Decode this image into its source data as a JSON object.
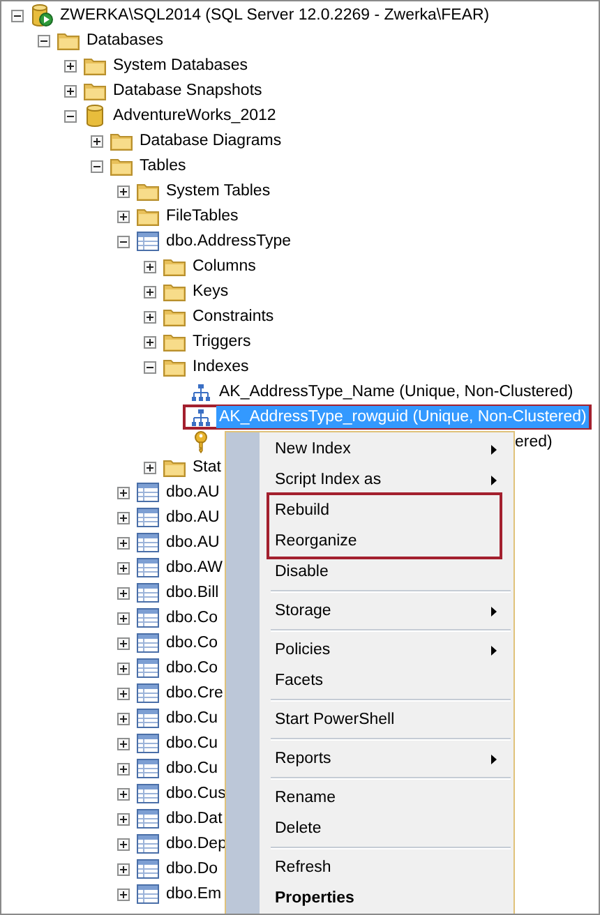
{
  "tree": [
    {
      "label": "ZWERKA\\SQL2014 (SQL Server 12.0.2269 - Zwerka\\FEAR)",
      "kind": "server",
      "expanded": true,
      "selected": false,
      "children": [
        {
          "label": "Databases",
          "kind": "folder",
          "expanded": true,
          "selected": false,
          "children": [
            {
              "label": "System Databases",
              "kind": "folder",
              "expanded": false,
              "selected": false
            },
            {
              "label": "Database Snapshots",
              "kind": "folder",
              "expanded": false,
              "selected": false
            },
            {
              "label": "AdventureWorks_2012",
              "kind": "database",
              "expanded": true,
              "selected": false,
              "children": [
                {
                  "label": "Database Diagrams",
                  "kind": "folder",
                  "expanded": false,
                  "selected": false
                },
                {
                  "label": "Tables",
                  "kind": "folder",
                  "expanded": true,
                  "selected": false,
                  "children": [
                    {
                      "label": "System Tables",
                      "kind": "folder",
                      "expanded": false,
                      "selected": false
                    },
                    {
                      "label": "FileTables",
                      "kind": "folder",
                      "expanded": false,
                      "selected": false
                    },
                    {
                      "label": "dbo.AddressType",
                      "kind": "table",
                      "expanded": true,
                      "selected": false,
                      "children": [
                        {
                          "label": "Columns",
                          "kind": "folder",
                          "expanded": false,
                          "selected": false
                        },
                        {
                          "label": "Keys",
                          "kind": "folder",
                          "expanded": false,
                          "selected": false
                        },
                        {
                          "label": "Constraints",
                          "kind": "folder",
                          "expanded": false,
                          "selected": false
                        },
                        {
                          "label": "Triggers",
                          "kind": "folder",
                          "expanded": false,
                          "selected": false
                        },
                        {
                          "label": "Indexes",
                          "kind": "folder",
                          "expanded": true,
                          "selected": false,
                          "children": [
                            {
                              "label": "AK_AddressType_Name (Unique, Non-Clustered)",
                              "kind": "index",
                              "selected": false,
                              "highlighted": false
                            },
                            {
                              "label": "AK_AddressType_rowguid (Unique, Non-Clustered)",
                              "kind": "index",
                              "selected": true,
                              "highlighted": true
                            },
                            {
                              "label_tail": "ered)",
                              "kind": "key",
                              "selected": false,
                              "highlighted": false
                            }
                          ]
                        },
                        {
                          "label": "Stat",
                          "kind": "folder",
                          "expanded": false,
                          "selected": false
                        }
                      ]
                    },
                    {
                      "label": "dbo.AU",
                      "kind": "table",
                      "expanded": false,
                      "selected": false
                    },
                    {
                      "label": "dbo.AU",
                      "kind": "table",
                      "expanded": false,
                      "selected": false
                    },
                    {
                      "label": "dbo.AU",
                      "kind": "table",
                      "expanded": false,
                      "selected": false
                    },
                    {
                      "label": "dbo.AW",
                      "kind": "table",
                      "expanded": false,
                      "selected": false
                    },
                    {
                      "label": "dbo.Bill",
                      "kind": "table",
                      "expanded": false,
                      "selected": false
                    },
                    {
                      "label": "dbo.Co",
                      "kind": "table",
                      "expanded": false,
                      "selected": false
                    },
                    {
                      "label": "dbo.Co",
                      "kind": "table",
                      "expanded": false,
                      "selected": false
                    },
                    {
                      "label": "dbo.Co",
                      "kind": "table",
                      "expanded": false,
                      "selected": false
                    },
                    {
                      "label": "dbo.Cre",
                      "kind": "table",
                      "expanded": false,
                      "selected": false
                    },
                    {
                      "label": "dbo.Cu",
                      "kind": "table",
                      "expanded": false,
                      "selected": false
                    },
                    {
                      "label": "dbo.Cu",
                      "kind": "table",
                      "expanded": false,
                      "selected": false
                    },
                    {
                      "label": "dbo.Cu",
                      "kind": "table",
                      "expanded": false,
                      "selected": false
                    },
                    {
                      "label": "dbo.Cus",
                      "kind": "table",
                      "expanded": false,
                      "selected": false
                    },
                    {
                      "label": "dbo.Dat",
                      "kind": "table",
                      "expanded": false,
                      "selected": false
                    },
                    {
                      "label": "dbo.Dep",
                      "kind": "table",
                      "expanded": false,
                      "selected": false
                    },
                    {
                      "label": "dbo.Do",
                      "kind": "table",
                      "expanded": false,
                      "selected": false
                    },
                    {
                      "label": "dbo.Em",
                      "kind": "table",
                      "expanded": false,
                      "selected": false
                    }
                  ]
                }
              ]
            }
          ]
        }
      ]
    }
  ],
  "context_menu": [
    {
      "kind": "item",
      "label": "New Index",
      "submenu": true,
      "boxed": false
    },
    {
      "kind": "item",
      "label": "Script Index as",
      "submenu": true,
      "boxed": false
    },
    {
      "kind": "item",
      "label": "Rebuild",
      "submenu": false,
      "boxed": true
    },
    {
      "kind": "item",
      "label": "Reorganize",
      "submenu": false,
      "boxed": true
    },
    {
      "kind": "item",
      "label": "Disable",
      "submenu": false,
      "boxed": false
    },
    {
      "kind": "separator"
    },
    {
      "kind": "item",
      "label": "Storage",
      "submenu": true,
      "boxed": false
    },
    {
      "kind": "separator"
    },
    {
      "kind": "item",
      "label": "Policies",
      "submenu": true,
      "boxed": false
    },
    {
      "kind": "item",
      "label": "Facets",
      "submenu": false,
      "boxed": false
    },
    {
      "kind": "separator"
    },
    {
      "kind": "item",
      "label": "Start PowerShell",
      "submenu": false,
      "boxed": false
    },
    {
      "kind": "separator"
    },
    {
      "kind": "item",
      "label": "Reports",
      "submenu": true,
      "boxed": false
    },
    {
      "kind": "separator"
    },
    {
      "kind": "item",
      "label": "Rename",
      "submenu": false,
      "boxed": false
    },
    {
      "kind": "item",
      "label": "Delete",
      "submenu": false,
      "boxed": false
    },
    {
      "kind": "separator"
    },
    {
      "kind": "item",
      "label": "Refresh",
      "submenu": false,
      "boxed": false
    },
    {
      "kind": "default",
      "label": "Properties",
      "submenu": false,
      "boxed": false
    }
  ]
}
